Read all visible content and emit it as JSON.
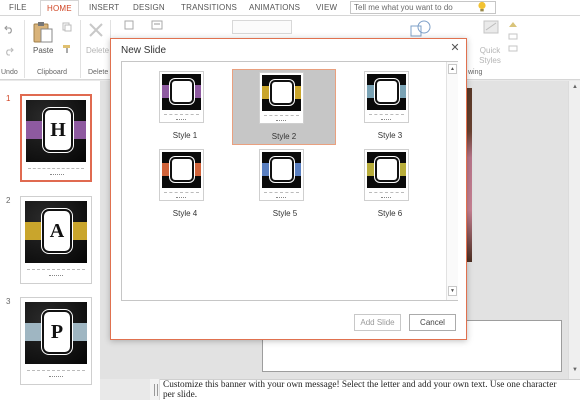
{
  "ribbon_tabs": [
    "FILE",
    "HOME",
    "INSERT",
    "DESIGN",
    "TRANSITIONS",
    "ANIMATIONS",
    "VIEW"
  ],
  "active_tab": "HOME",
  "tell_me": {
    "placeholder": "Tell me what you want to do"
  },
  "ribbon": {
    "undo_label": "Undo",
    "clipboard_label": "Clipboard",
    "paste_label": "Paste",
    "delete_label": "Delete",
    "delete_group_label": "Delete",
    "quick_styles_label": "Quick Styles",
    "drawing_label": "wing"
  },
  "thumbnails": [
    {
      "number": "1",
      "letter": "H",
      "band_color": "#8e5aa0",
      "selected": true
    },
    {
      "number": "2",
      "letter": "A",
      "band_color": "#c9a52c",
      "selected": false
    },
    {
      "number": "3",
      "letter": "P",
      "band_color": "#9fb6c2",
      "selected": false
    }
  ],
  "dialog": {
    "title": "New Slide",
    "styles": [
      {
        "label": "Style 1",
        "accent": "#8e5aa0",
        "selected": false
      },
      {
        "label": "Style 2",
        "accent": "#c9a52c",
        "selected": true
      },
      {
        "label": "Style 3",
        "accent": "#7aa3b5",
        "selected": false
      },
      {
        "label": "Style 4",
        "accent": "#d0633a",
        "selected": false
      },
      {
        "label": "Style 5",
        "accent": "#5a7fc0",
        "selected": false
      },
      {
        "label": "Style 6",
        "accent": "#b8ad3a",
        "selected": false
      }
    ],
    "add_button": "Add Slide",
    "cancel_button": "Cancel"
  },
  "notes": {
    "text": "Customize this banner with your own message! Select the letter and add your own text. Use one character per slide."
  },
  "colors": {
    "accent": "#d04423",
    "dialog_border": "#e0714f",
    "selection_fill": "#c6c6c6"
  }
}
